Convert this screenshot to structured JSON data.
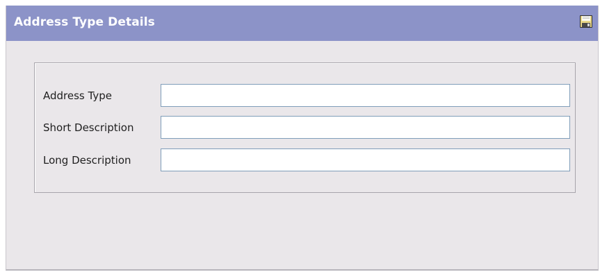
{
  "panel": {
    "title": "Address Type Details",
    "save_icon": "floppy-disk-save-icon",
    "title_bar_color": "#8c93c8",
    "background_color": "#eae7ea"
  },
  "form": {
    "fields": [
      {
        "label": "Address Type",
        "value": "",
        "placeholder": ""
      },
      {
        "label": "Short Description",
        "value": "",
        "placeholder": ""
      },
      {
        "label": "Long Description",
        "value": "",
        "placeholder": ""
      }
    ]
  }
}
